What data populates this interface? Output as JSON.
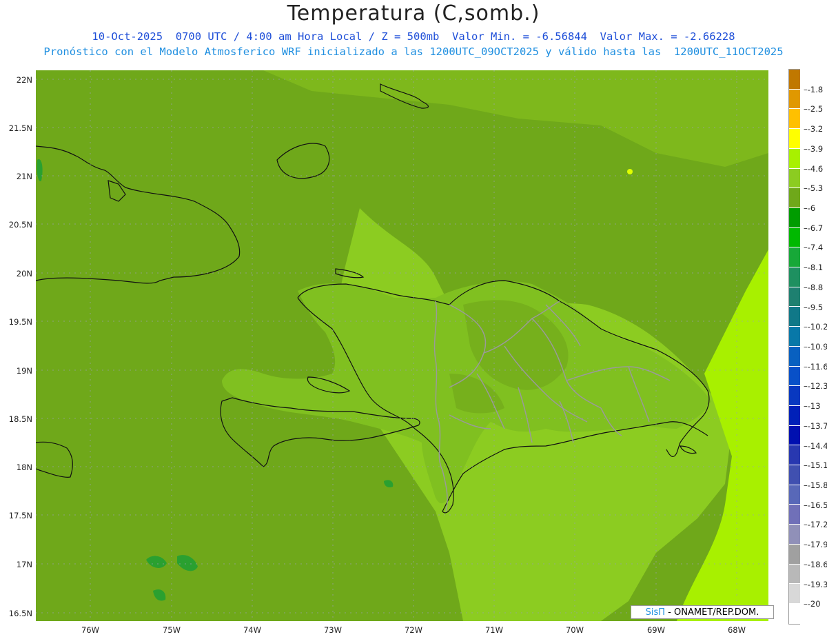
{
  "title": "Temperatura (C,somb.)",
  "subtitle_line1": "10-Oct-2025  0700 UTC / 4:00 am Hora Local / Z = 500mb  Valor Min. = -6.56844  Valor Max. = -2.66228",
  "subtitle_line2": "Pronóstico con el Modelo Atmosferico WRF inicializado a las 1200UTC_09OCT2025 y válido hasta las  1200UTC_11OCT2025",
  "colors": {
    "title": "#222222",
    "subtitle1": "#1f4fd8",
    "subtitle2": "#1f8fe0",
    "ocean_base": "#6fa81a",
    "land_mid": "#8ccc21",
    "east_warm": "#a8f000",
    "coast": "#111111",
    "border": "#9a9a9a"
  },
  "map": {
    "lat_labels": [
      "22N",
      "21.5N",
      "21N",
      "20.5N",
      "20N",
      "19.5N",
      "19N",
      "18.5N",
      "18N",
      "17.5N",
      "17N",
      "16.5N"
    ],
    "lon_labels": [
      "76W",
      "75W",
      "74W",
      "73W",
      "72W",
      "71W",
      "70W",
      "69W",
      "68W"
    ],
    "legend_icon": "contour-fill-map"
  },
  "colorbar": {
    "labels": [
      "-1.8",
      "-2.5",
      "-3.2",
      "-3.9",
      "-4.6",
      "-5.3",
      "-6",
      "-6.7",
      "-7.4",
      "-8.1",
      "-8.8",
      "-9.5",
      "-10.2",
      "-10.9",
      "-11.6",
      "-12.3",
      "-13",
      "-13.7",
      "-14.4",
      "-15.1",
      "-15.8",
      "-16.5",
      "-17.2",
      "-17.9",
      "-18.6",
      "-19.3",
      "-20"
    ],
    "colors": [
      "#c07800",
      "#e09800",
      "#ffc000",
      "#ffff00",
      "#a8f000",
      "#8ccc21",
      "#6fa81a",
      "#009c00",
      "#00b800",
      "#17a838",
      "#1e9060",
      "#1e8070",
      "#107888",
      "#0878a8",
      "#0860c0",
      "#0850c8",
      "#0838c0",
      "#0020b8",
      "#0010b0",
      "#2838b0",
      "#4050b0",
      "#5868b8",
      "#7070b8",
      "#9090b8",
      "#a0a0a0",
      "#b8b8b8",
      "#d8d8d8",
      "#ffffff"
    ]
  },
  "credit": {
    "brand": "SisΠ",
    "separator": " - ",
    "org": "ONAMET/REP.DOM."
  }
}
